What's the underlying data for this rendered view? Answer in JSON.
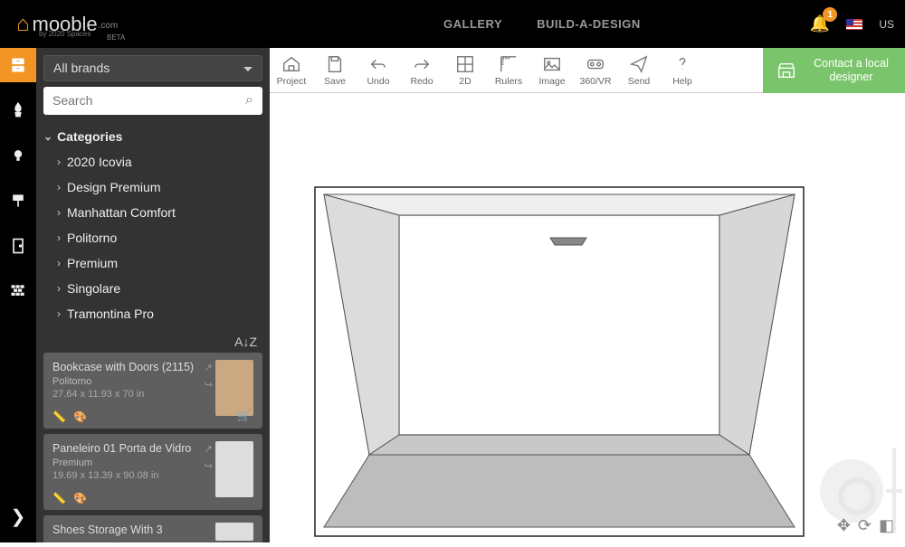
{
  "header": {
    "logo_main": "mooble",
    "logo_com": ".com",
    "logo_sub": "by 2020 Spaces",
    "logo_beta": "BETA",
    "nav": [
      "GALLERY",
      "BUILD-A-DESIGN"
    ],
    "badge": "1",
    "region": "US"
  },
  "rail": [
    "furniture",
    "plants",
    "lighting",
    "paint",
    "doors",
    "materials"
  ],
  "sidebar": {
    "brand_selected": "All brands",
    "search_placeholder": "Search",
    "cats_header": "Categories",
    "cats": [
      "2020 Icovia",
      "Design Premium",
      "Manhattan Comfort",
      "Politorno",
      "Premium",
      "Singolare",
      "Tramontina Pro"
    ],
    "sort": "A↓Z"
  },
  "products": [
    {
      "title": "Bookcase with Doors (2115)",
      "brand": "Politorno",
      "dim": "27.64 x 11.93 x 70 in"
    },
    {
      "title": "Paneleiro 01 Porta de Vidro",
      "brand": "Premium",
      "dim": "19.69 x 13.39 x 90.08 in"
    },
    {
      "title": "Shoes Storage With 3",
      "brand": "",
      "dim": ""
    }
  ],
  "toolbar": [
    "Project",
    "Save",
    "Undo",
    "Redo",
    "2D",
    "Rulers",
    "Image",
    "360/VR",
    "Send",
    "Help"
  ],
  "contact": "Contact a local designer"
}
